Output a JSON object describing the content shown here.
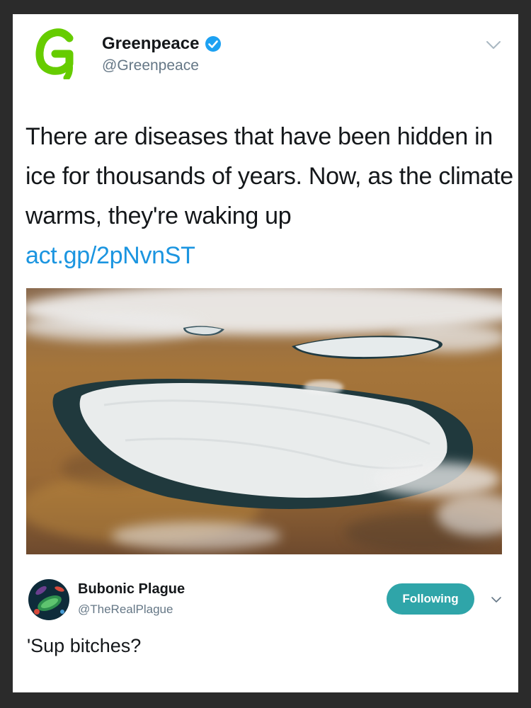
{
  "tweet": {
    "author": {
      "name": "Greenpeace",
      "handle": "@Greenpeace",
      "logo_letter": "G",
      "verified": true,
      "avatar_icon": "greenpeace-logo-icon"
    },
    "text": "There are diseases that have been hidden in ice for thousands of years. Now, as the climate warms, they're waking up",
    "link": "act.gp/2pNvnST",
    "image_icon": "frozen-lake-aerial-photo",
    "menu_icon": "chevron-down-icon"
  },
  "reply": {
    "author": {
      "name": "Bubonic Plague",
      "handle": "@TheRealPlague",
      "avatar_icon": "bacteria-avatar-icon"
    },
    "follow_label": "Following",
    "text": "'Sup bitches?",
    "menu_icon": "chevron-down-icon"
  },
  "colors": {
    "link": "#1b95e0",
    "greenpeace_green": "#66cc00",
    "follow_button": "#2fa5a9",
    "verified_blue": "#1da1f2",
    "background": "#2b2b2b"
  }
}
